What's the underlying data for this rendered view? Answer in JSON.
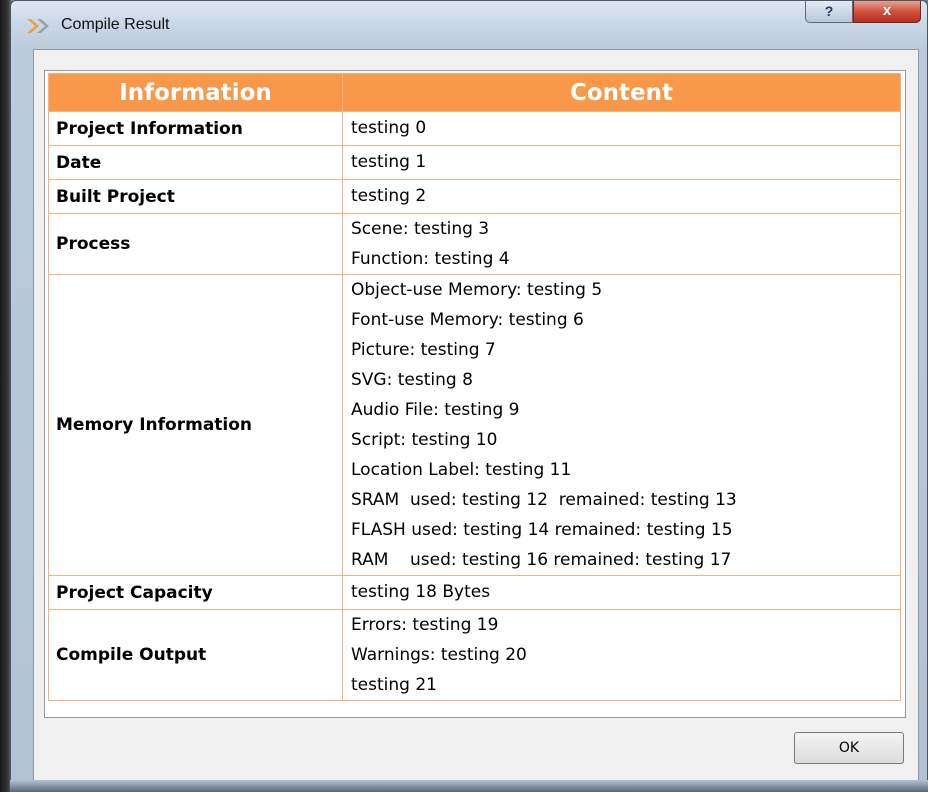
{
  "window": {
    "title": "Compile Result",
    "help_label": "?",
    "close_label": "x"
  },
  "table": {
    "headers": [
      "Information",
      "Content"
    ],
    "rows": [
      {
        "label": "Project Information",
        "lines": [
          "testing 0"
        ]
      },
      {
        "label": "Date",
        "lines": [
          "testing 1"
        ]
      },
      {
        "label": "Built Project",
        "lines": [
          "testing 2"
        ]
      },
      {
        "label": "Process",
        "lines": [
          "Scene: testing 3",
          "Function: testing 4"
        ]
      },
      {
        "label": "Memory Information",
        "lines": [
          "Object-use Memory: testing 5",
          "Font-use Memory: testing 6",
          "Picture: testing 7",
          "SVG: testing 8",
          "Audio File: testing 9",
          "Script: testing 10",
          "Location Label: testing 11",
          "SRAM  used: testing 12  remained: testing 13",
          "FLASH used: testing 14 remained: testing 15",
          "RAM    used: testing 16 remained: testing 17"
        ]
      },
      {
        "label": "Project Capacity",
        "lines": [
          "testing 18 Bytes"
        ]
      },
      {
        "label": "Compile Output",
        "lines": [
          "Errors: testing 19",
          "Warnings: testing 20",
          "testing 21"
        ]
      }
    ]
  },
  "buttons": {
    "ok_label": "OK"
  },
  "colors": {
    "header_bg": "#f7984a",
    "cell_border": "#f4b27c"
  }
}
